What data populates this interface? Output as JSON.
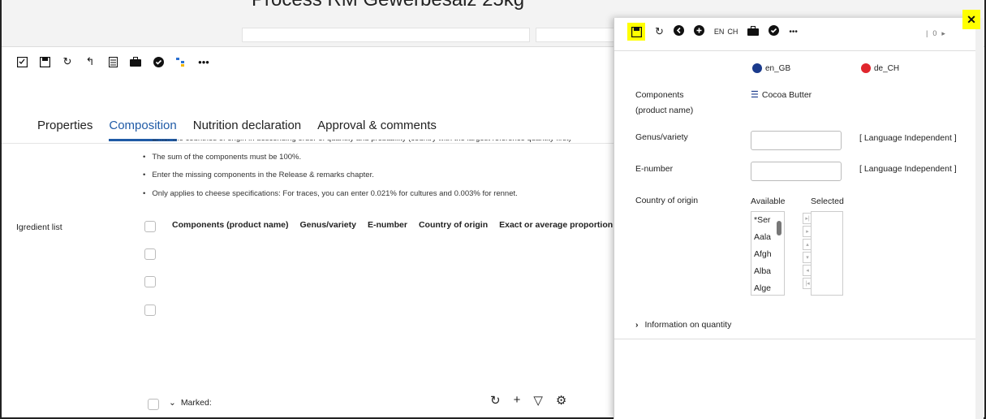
{
  "header": {
    "title": "Process RM Gewerbesalz 25kg"
  },
  "toolbar": {
    "icons": [
      "checklist-icon",
      "save-icon",
      "undo-icon",
      "reply-icon",
      "document-icon",
      "briefcase-icon",
      "check-circle-icon",
      "tree-icon",
      "more-icon"
    ]
  },
  "tabs": [
    {
      "label": "Properties"
    },
    {
      "label": "Composition"
    },
    {
      "label": "Nutrition declaration"
    },
    {
      "label": "Approval & comments"
    }
  ],
  "instructions": [
    "Enter the countries of origin in descending order of quantity and probability (country with the largest reference quantity first)",
    "The sum of the components must be 100%.",
    "Enter the missing components in the Release & remarks chapter.",
    "Only applies to cheese specifications: For traces, you can enter 0.021% for cultures and 0.003% for rennet."
  ],
  "ingredient": {
    "label": "Igredient list",
    "columns": [
      "Components (product name)",
      "Genus/variety",
      "E-number",
      "Country of origin",
      "Exact or average proportion i"
    ],
    "marked": "Marked:"
  },
  "panel": {
    "lang_labels": [
      "EN",
      "CH"
    ],
    "pager": "0",
    "languages": [
      {
        "code": "en_GB",
        "color": "#1a3a8c"
      },
      {
        "code": "de_CH",
        "color": "#e0262d"
      }
    ],
    "components_label": "Components",
    "components_sublabel": "(product name)",
    "component_value": "Cocoa Butter",
    "genus_label": "Genus/variety",
    "enumber_label": "E-number",
    "lang_independent": "[ Language Independent ]",
    "country_label": "Country of origin",
    "available_label": "Available",
    "selected_label": "Selected",
    "available_items": [
      "*Ser",
      "Aala",
      "Afgh",
      "Alba",
      "Alge"
    ],
    "info_label": "Information on quantity"
  },
  "colors": {
    "accent": "#1f5aa6",
    "highlight": "#ffff00"
  }
}
